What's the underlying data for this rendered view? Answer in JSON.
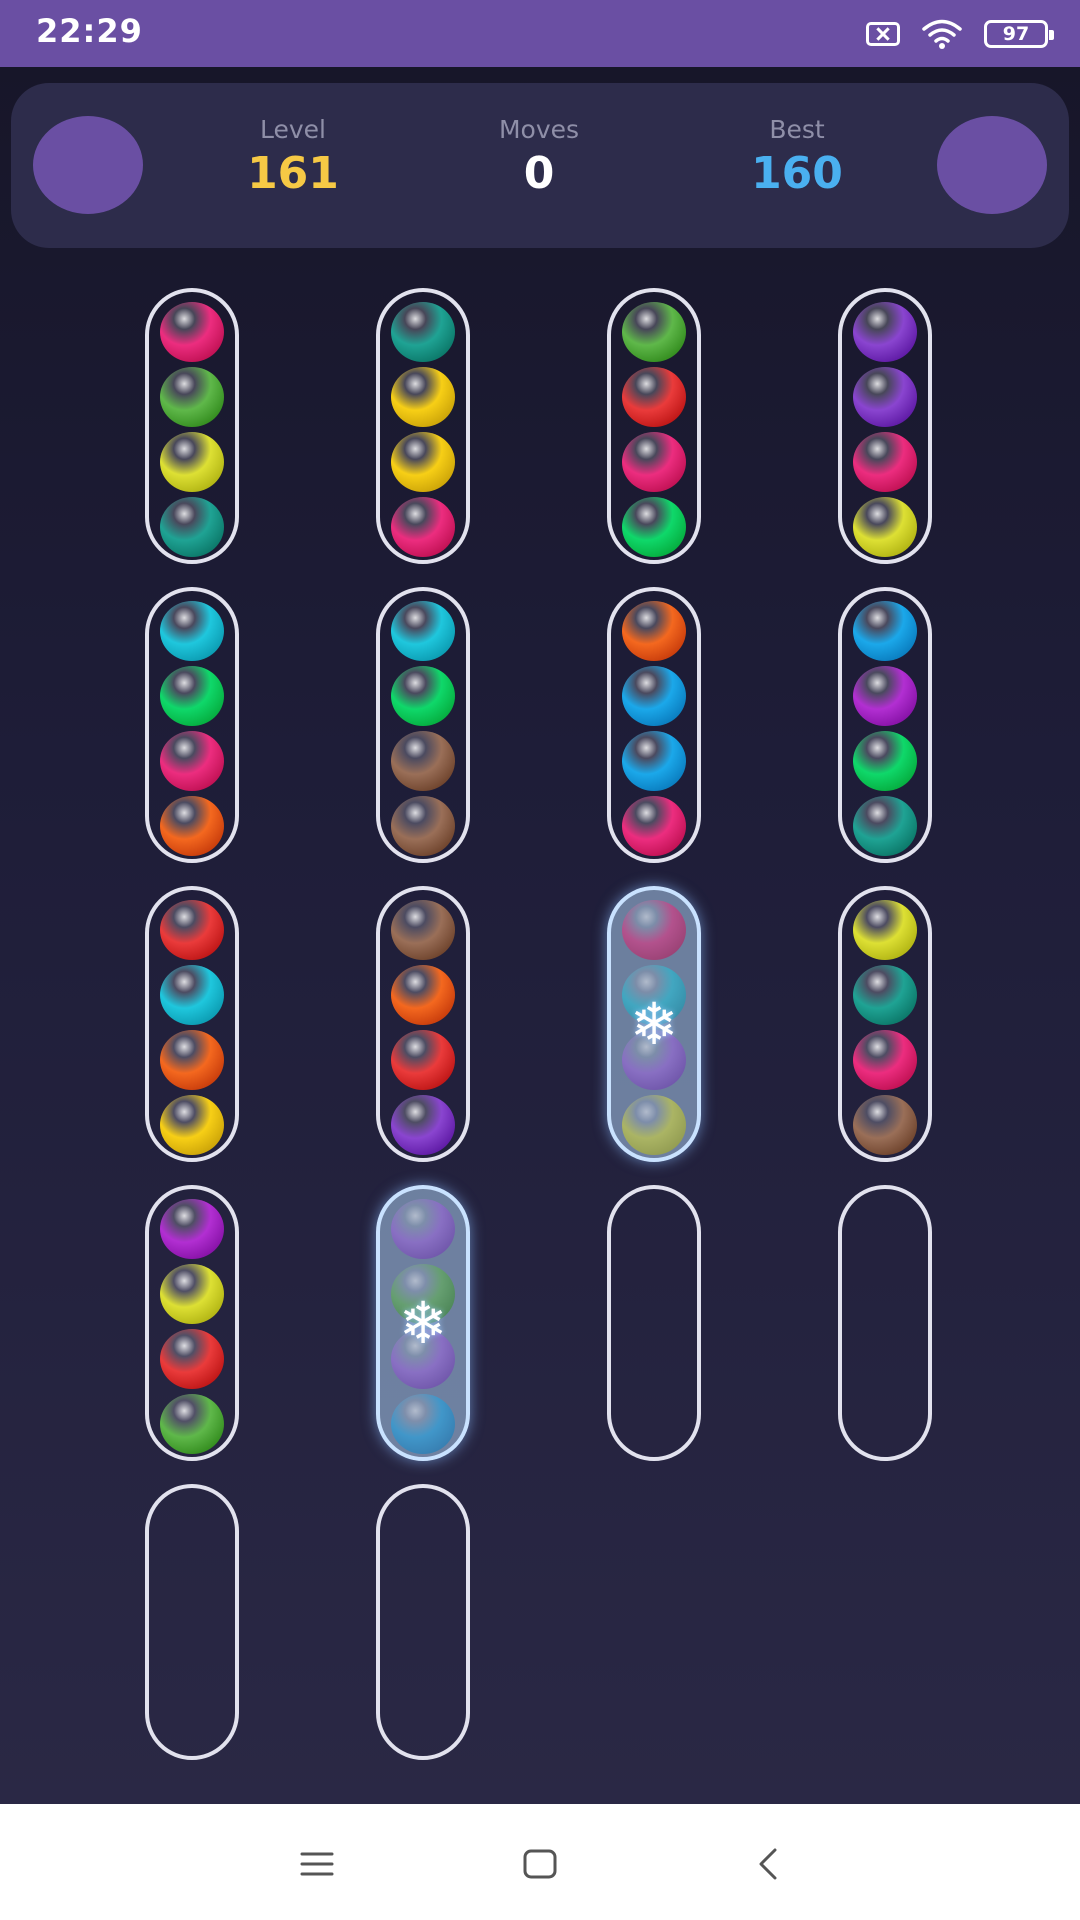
{
  "status_bar": {
    "time": "22:29",
    "battery": "97",
    "icons": [
      "sim-off-icon",
      "wifi-icon",
      "battery-icon"
    ]
  },
  "header": {
    "left_button_icon": "circle-button",
    "right_button_icon": "circle-button",
    "stats": [
      {
        "label": "Level",
        "value": "161",
        "color": "#f6c945"
      },
      {
        "label": "Moves",
        "value": "0",
        "color": "#ffffff"
      },
      {
        "label": "Best",
        "value": "160",
        "color": "#4ab0f0"
      }
    ]
  },
  "colors": {
    "pink": "#ec2d7f",
    "green": "#5fb84a",
    "yellow": "#dde034",
    "teal": "#1fa394",
    "gold": "#f7cf16",
    "red": "#ea3b3b",
    "purple": "#8a45d0",
    "cyan": "#1fc7dd",
    "lime": "#0fd86a",
    "orange": "#f4681f",
    "blue": "#1ba8ea",
    "brown": "#9a6f58",
    "magenta": "#b22fd2",
    "lavender": "#9f62e0"
  },
  "tubes": [
    {
      "balls": [
        "pink",
        "green",
        "yellow",
        "teal"
      ],
      "frozen": false
    },
    {
      "balls": [
        "teal",
        "gold",
        "gold",
        "pink"
      ],
      "frozen": false
    },
    {
      "balls": [
        "green",
        "red",
        "pink",
        "lime"
      ],
      "frozen": false
    },
    {
      "balls": [
        "purple",
        "purple",
        "pink",
        "yellow"
      ],
      "frozen": false
    },
    {
      "balls": [
        "cyan",
        "lime",
        "pink",
        "orange"
      ],
      "frozen": false
    },
    {
      "balls": [
        "cyan",
        "lime",
        "brown",
        "brown"
      ],
      "frozen": false
    },
    {
      "balls": [
        "orange",
        "blue",
        "blue",
        "pink"
      ],
      "frozen": false
    },
    {
      "balls": [
        "blue",
        "magenta",
        "lime",
        "teal"
      ],
      "frozen": false
    },
    {
      "balls": [
        "red",
        "cyan",
        "orange",
        "gold"
      ],
      "frozen": false
    },
    {
      "balls": [
        "brown",
        "orange",
        "red",
        "purple"
      ],
      "frozen": false
    },
    {
      "balls": [
        "pink",
        "cyan",
        "lavender",
        "yellow"
      ],
      "frozen": true
    },
    {
      "balls": [
        "yellow",
        "teal",
        "pink",
        "brown"
      ],
      "frozen": false
    },
    {
      "balls": [
        "magenta",
        "yellow",
        "red",
        "green"
      ],
      "frozen": false
    },
    {
      "balls": [
        "lavender",
        "green",
        "lavender",
        "blue"
      ],
      "frozen": true
    },
    {
      "balls": [],
      "frozen": false
    },
    {
      "balls": [],
      "frozen": false
    },
    {
      "balls": [],
      "frozen": false
    },
    {
      "balls": [],
      "frozen": false
    }
  ],
  "frozen_icon": "❄",
  "nav_bar": {
    "icons": [
      "menu-icon",
      "home-icon",
      "back-icon"
    ]
  }
}
